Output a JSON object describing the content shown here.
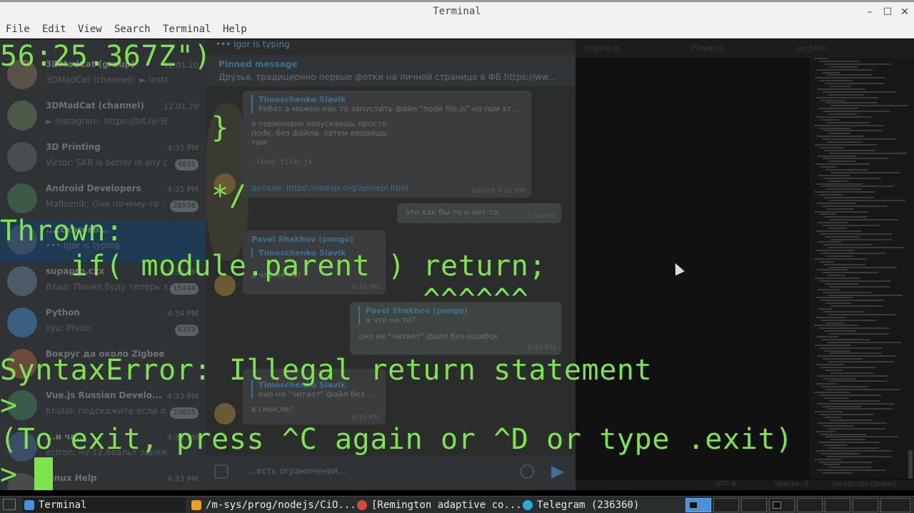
{
  "window": {
    "title": "Terminal",
    "controls": {
      "minimize": "–",
      "maximize": "☐",
      "close": "✕"
    }
  },
  "menu": [
    "File",
    "Edit",
    "View",
    "Search",
    "Terminal",
    "Help"
  ],
  "terminal": {
    "lines": [
      "56:25.367Z\")",
      "            }",
      "",
      "            */",
      "Thrown:",
      "    if( module.parent ) return;",
      "                        ^^^^^^",
      "",
      "SyntaxError: Illegal return statement",
      ">",
      "(To exit, press ^C again or ^D or type .exit)",
      "> "
    ],
    "text_color": "#7ee34f"
  },
  "telegram": {
    "typing": "••• Igor is typing",
    "pinned": {
      "header": "Pinned message",
      "text": "Друзья, традиционно первые фотки на личной странице в ФБ https://ww..."
    },
    "chats": [
      {
        "name": "3DMadCat (group)",
        "preview": "3DMadCat (channel): ► Instagra...",
        "time": "12.01.20",
        "badge": ""
      },
      {
        "name": "3DMadCat (channel)",
        "preview": "► Instagram: https://bit.ly/3DMa...",
        "time": "12.01.20",
        "badge": ""
      },
      {
        "name": "3D Printing",
        "preview": "Victor: SKR is better in any ca...",
        "time": "4:35 PM",
        "badge": "4831"
      },
      {
        "name": "Android Developers",
        "preview": "Mafioznik: Они почему-то ...",
        "time": "4:35 PM",
        "badge": "26536"
      },
      {
        "name": "...сскогово...",
        "preview": "••• Igor is typing",
        "time": "",
        "badge": ""
      },
      {
        "name": "supapro.cxx",
        "preview": "Влад: Понял,буду теперь з...",
        "time": "4:35 PM",
        "badge": "15444"
      },
      {
        "name": "Python",
        "preview": "Ilya: Photo",
        "time": "4:34 PM",
        "badge": "6353"
      },
      {
        "name": "Вокруг да около Zigbee",
        "preview": "",
        "time": "",
        "badge": ""
      },
      {
        "name": "Vue.js Russian Develo...",
        "preview": "Kristal: подскажите если л...",
        "time": "4:33 PM",
        "badge": "20825"
      },
      {
        "name": "...и ча...",
        "preview": "ectron: ну 12.6вальт заряж...",
        "time": "4:33 PM",
        "badge": ""
      },
      {
        "name": "Linux Help",
        "preview": "...",
        "time": "4:33 PM",
        "badge": ""
      }
    ],
    "messages": [
      {
        "quote": "Timoschenko Slavik",
        "quote_text": "Ребят а можно как то запустить файл \"node file.js\" но при эт...",
        "text": "в терминале запускаешь просто node, без файла. затем вводишь там:",
        "code": ".load file.js",
        "link_text": "детали: https://nodejs.org/api/repl.html",
        "time": "edited 4:31 PM"
      },
      {
        "text": "это как бы то и нет то.",
        "time": "4:34 PM"
      },
      {
        "author": "Pavel Shakhov (pongo)",
        "quote": "Timoschenko Slavik",
        "text": "а что не то?",
        "time": "4:34 PM"
      },
      {
        "quote": "Pavel Shakhov (pongo)",
        "quote_text": "а что не то?",
        "text": "оно не \"читает\" файл без ошибок",
        "time": "4:34 PM"
      },
      {
        "quote": "Timoschenko Slavik",
        "quote_text": "оно не \"читает\" файл без ...",
        "text": "в смысле?",
        "time": "4:35 PM"
      }
    ],
    "input_placeholder": "...есть ограничения..."
  },
  "editor": {
    "tabs": [
      "Engine.js",
      "Player.js",
      "go.html"
    ],
    "status": [
      "UTF-8",
      "Spaces: 2",
      "JavaScript (Babel)"
    ]
  },
  "taskbar": {
    "items": [
      {
        "label": "Terminal",
        "icon_color": "#4a90d9"
      },
      {
        "label": "/m-sys/prog/nodejs/CiO...",
        "icon_color": "#f0a020"
      },
      {
        "label": "[Remington adaptive co...",
        "icon_color": "#d84a38"
      },
      {
        "label": "Telegram (236360)",
        "icon_color": "#2ea6da"
      }
    ]
  }
}
